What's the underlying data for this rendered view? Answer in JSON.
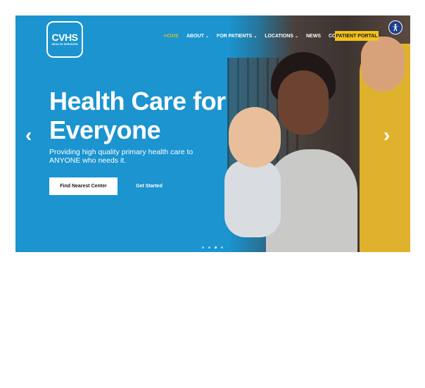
{
  "brand": {
    "logo_text": "CVHS",
    "logo_subtext": "HEALTH SERVICES"
  },
  "nav": {
    "items": [
      {
        "label": "HOME",
        "active": true,
        "dropdown": false
      },
      {
        "label": "ABOUT",
        "active": false,
        "dropdown": true
      },
      {
        "label": "FOR PATIENTS",
        "active": false,
        "dropdown": true
      },
      {
        "label": "LOCATIONS",
        "active": false,
        "dropdown": true
      },
      {
        "label": "NEWS",
        "active": false,
        "dropdown": false
      },
      {
        "label": "CONTACT",
        "active": false,
        "dropdown": false
      }
    ],
    "portal_label": "PATIENT PORTAL",
    "accessibility_icon": "accessibility-icon"
  },
  "hero": {
    "headline": "Health Care for Everyone",
    "subheadline": "Providing high quality primary health care to ANYONE who needs it.",
    "primary_button": "Find Nearest Center",
    "secondary_button": "Get Started",
    "prev_icon": "chevron-left-icon",
    "next_icon": "chevron-right-icon",
    "slide_count": 4,
    "active_slide": 1
  },
  "colors": {
    "hero_blue": "#1b94d0",
    "accent_yellow": "#f4c21b",
    "white": "#ffffff"
  }
}
